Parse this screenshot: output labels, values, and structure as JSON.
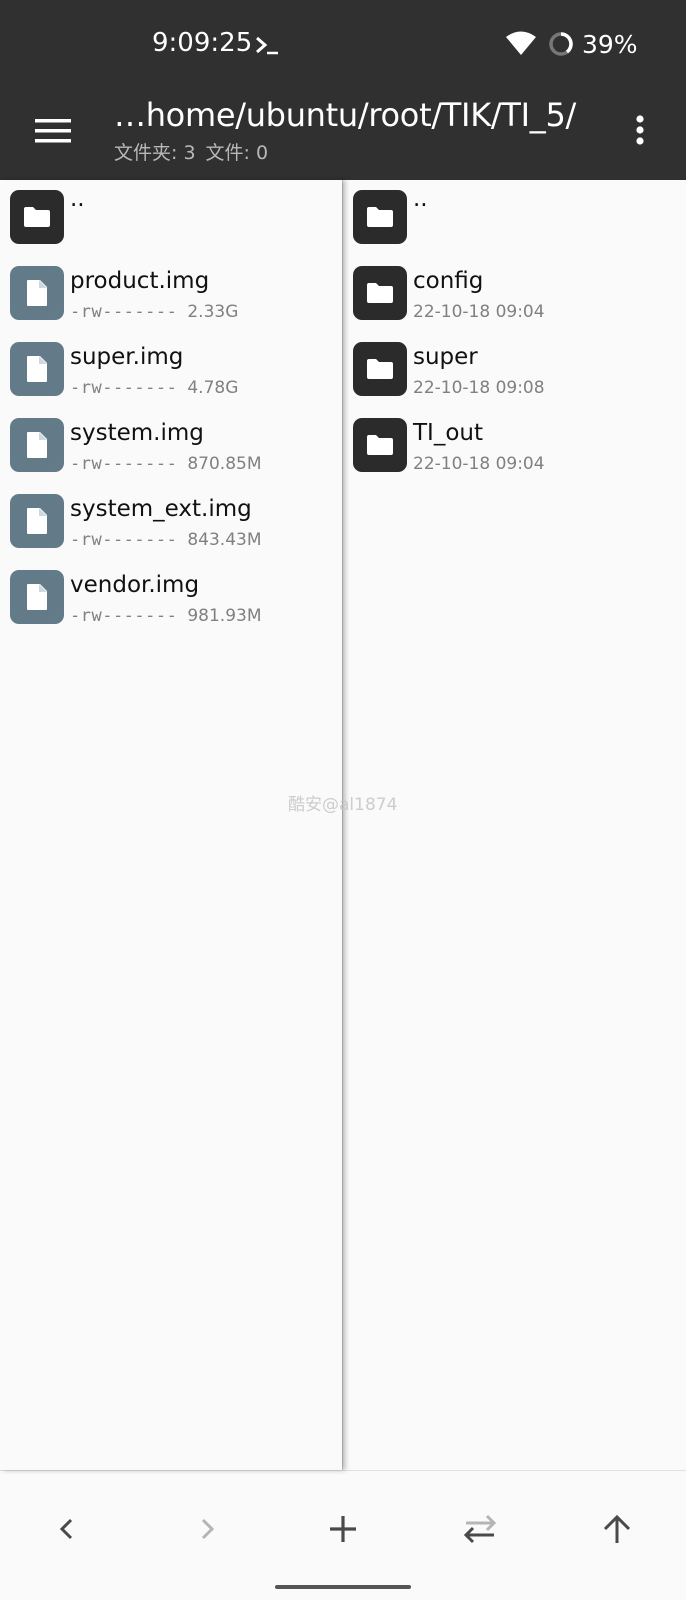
{
  "status_bar": {
    "time": "9:09:25",
    "battery": "39%",
    "icons": [
      "terminal-icon",
      "wifi-icon",
      "battery-saver-icon"
    ]
  },
  "app_bar": {
    "path": "…home/ubuntu/root/TIK/TI_5/",
    "folder_count": "文件夹: 3",
    "file_count": "文件: 0"
  },
  "left_pane": {
    "parent": "..",
    "items": [
      {
        "name": "product.img",
        "perm": "-rw-------",
        "size": "2.33G"
      },
      {
        "name": "super.img",
        "perm": "-rw-------",
        "size": "4.78G"
      },
      {
        "name": "system.img",
        "perm": "-rw-------",
        "size": "870.85M"
      },
      {
        "name": "system_ext.img",
        "perm": "-rw-------",
        "size": "843.43M"
      },
      {
        "name": "vendor.img",
        "perm": "-rw-------",
        "size": "981.93M"
      }
    ]
  },
  "right_pane": {
    "parent": "..",
    "items": [
      {
        "name": "config",
        "date": "22-10-18 09:04"
      },
      {
        "name": "super",
        "date": "22-10-18 09:08"
      },
      {
        "name": "TI_out",
        "date": "22-10-18 09:04"
      }
    ]
  },
  "watermark": "酷安@al1874",
  "bottom_bar": {
    "buttons": [
      "back-icon",
      "forward-icon",
      "add-icon",
      "swap-icon",
      "up-icon"
    ]
  },
  "colors": {
    "bar_background": "#303030",
    "folder_icon_bg": "#2b2b2b",
    "file_icon_bg": "#637b88",
    "page_background": "#fafafa"
  }
}
